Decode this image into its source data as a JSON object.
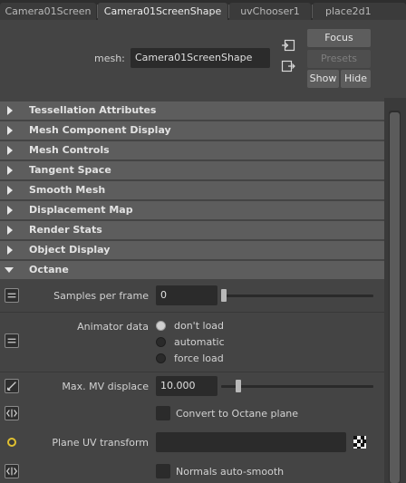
{
  "tabs": [
    {
      "label": "Camera01Screen",
      "active": false
    },
    {
      "label": "Camera01ScreenShape",
      "active": true
    },
    {
      "label": "uvChooser1",
      "active": false
    },
    {
      "label": "place2d1",
      "active": false
    }
  ],
  "header": {
    "mesh_label": "mesh:",
    "mesh_value": "Camera01ScreenShape",
    "focus_label": "Focus",
    "presets_label": "Presets",
    "show_label": "Show",
    "hide_label": "Hide"
  },
  "sections": [
    {
      "label": "Tessellation Attributes",
      "expanded": false
    },
    {
      "label": "Mesh Component Display",
      "expanded": false
    },
    {
      "label": "Mesh Controls",
      "expanded": false
    },
    {
      "label": "Tangent Space",
      "expanded": false
    },
    {
      "label": "Smooth Mesh",
      "expanded": false
    },
    {
      "label": "Displacement Map",
      "expanded": false
    },
    {
      "label": "Render Stats",
      "expanded": false
    },
    {
      "label": "Object Display",
      "expanded": false
    },
    {
      "label": "Octane",
      "expanded": true
    }
  ],
  "octane": {
    "samples_label": "Samples per frame",
    "samples_value": "0",
    "samples_slider": 0.0,
    "animator_label": "Animator data",
    "animator_options": [
      "don't load",
      "automatic",
      "force load"
    ],
    "animator_selected": 0,
    "max_mv_label": "Max. MV displace",
    "max_mv_value": "10.000",
    "max_mv_slider": 0.06,
    "convert_label": "Convert to Octane plane",
    "plane_uv_label": "Plane UV transform",
    "plane_uv_value": "",
    "normals_label": "Normals auto-smooth"
  },
  "colors": {
    "background": "#444444",
    "section_header": "#5d5d5d",
    "field": "#2b2b2b",
    "button": "#5d5d5d"
  }
}
